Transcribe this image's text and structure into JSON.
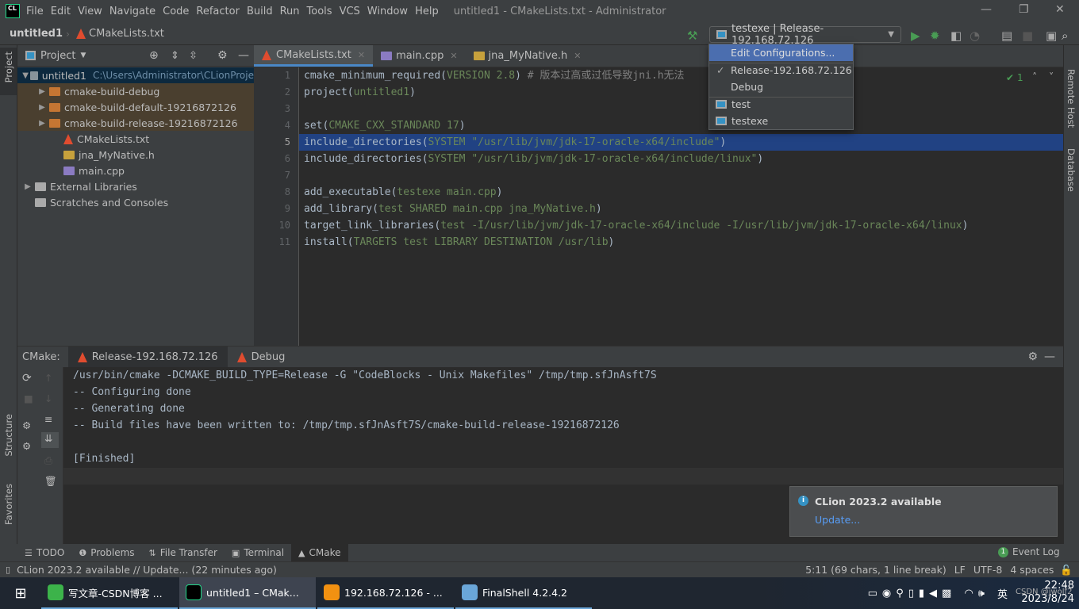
{
  "app": {
    "logo": "CL",
    "title": "untitled1 - CMakeLists.txt - Administrator"
  },
  "menu": [
    "File",
    "Edit",
    "View",
    "Navigate",
    "Code",
    "Refactor",
    "Build",
    "Run",
    "Tools",
    "VCS",
    "Window",
    "Help"
  ],
  "breadcrumb": {
    "project": "untitled1",
    "file": "CMakeLists.txt"
  },
  "run_config": {
    "selected": "testexe | Release-192.168.72.126"
  },
  "dropdown": {
    "edit": "Edit Configurations...",
    "profiles": [
      "Release-192.168.72.126",
      "Debug"
    ],
    "checked": "Release-192.168.72.126",
    "targets": [
      "test",
      "testexe"
    ]
  },
  "left_strip": {
    "project": "Project",
    "structure": "Structure",
    "favorites": "Favorites"
  },
  "right_strip": {
    "remote": "Remote Host",
    "database": "Database"
  },
  "project_panel": {
    "title": "Project",
    "tree": [
      {
        "label": "untitled1",
        "extra": "C:\\Users\\Administrator\\CLionProje",
        "type": "root"
      },
      {
        "label": "cmake-build-debug",
        "type": "folder"
      },
      {
        "label": "cmake-build-default-19216872126",
        "type": "folder"
      },
      {
        "label": "cmake-build-release-19216872126",
        "type": "folder"
      },
      {
        "label": "CMakeLists.txt",
        "type": "cmake"
      },
      {
        "label": "jna_MyNative.h",
        "type": "header"
      },
      {
        "label": "main.cpp",
        "type": "cpp"
      },
      {
        "label": "External Libraries",
        "type": "lib"
      },
      {
        "label": "Scratches and Consoles",
        "type": "scratch"
      }
    ]
  },
  "editor": {
    "tabs": [
      "CMakeLists.txt",
      "main.cpp",
      "jna_MyNative.h"
    ],
    "active_tab": "CMakeLists.txt",
    "inspection_count": "1",
    "current_line": 5,
    "lines": [
      [
        [
          "cmake_minimum_required(",
          ""
        ],
        [
          "VERSION 2.8",
          "g"
        ],
        [
          ") ",
          ""
        ],
        [
          "# 版本过高或过低导致jni.h无法",
          "c"
        ]
      ],
      [
        [
          "project(",
          ""
        ],
        [
          "untitled1",
          "g"
        ],
        [
          ")",
          ""
        ]
      ],
      [],
      [
        [
          "set(",
          ""
        ],
        [
          "CMAKE_CXX_STANDARD 17",
          "g"
        ],
        [
          ")",
          ""
        ]
      ],
      [
        [
          "include_directories(",
          ""
        ],
        [
          "SYSTEM \"/usr/lib/jvm/jdk-17-oracle-x64/include\"",
          "g"
        ],
        [
          ")",
          ""
        ]
      ],
      [
        [
          "include_directories(",
          ""
        ],
        [
          "SYSTEM \"/usr/lib/jvm/jdk-17-oracle-x64/include/linux\"",
          "g"
        ],
        [
          ")",
          ""
        ]
      ],
      [],
      [
        [
          "add_executable(",
          ""
        ],
        [
          "testexe main.cpp",
          "g"
        ],
        [
          ")",
          ""
        ]
      ],
      [
        [
          "add_library(",
          ""
        ],
        [
          "test SHARED main.cpp jna_MyNative.h",
          "g"
        ],
        [
          ")",
          ""
        ]
      ],
      [
        [
          "target_link_libraries(",
          ""
        ],
        [
          "test -I/usr/lib/jvm/jdk-17-oracle-x64/include -I/usr/lib/jvm/jdk-17-oracle-x64/linux",
          "g"
        ],
        [
          ")",
          ""
        ]
      ],
      [
        [
          "install(",
          ""
        ],
        [
          "TARGETS test LIBRARY DESTINATION /usr/lib",
          "g"
        ],
        [
          ")",
          ""
        ]
      ]
    ]
  },
  "cmake_panel": {
    "label": "CMake:",
    "tabs": [
      "Release-192.168.72.126",
      "Debug"
    ],
    "output": [
      "/usr/bin/cmake -DCMAKE_BUILD_TYPE=Release -G \"CodeBlocks - Unix Makefiles\" /tmp/tmp.sfJnAsft7S",
      "-- Configuring done",
      "-- Generating done",
      "-- Build files have been written to: /tmp/tmp.sfJnAsft7S/cmake-build-release-19216872126",
      "",
      "[Finished]"
    ]
  },
  "notification": {
    "title": "CLion 2023.2 available",
    "link": "Update..."
  },
  "tool_windows": [
    "TODO",
    "Problems",
    "File Transfer",
    "Terminal",
    "CMake"
  ],
  "active_tool": "CMake",
  "event_log": {
    "count": "1",
    "label": "Event Log"
  },
  "status": {
    "message": "CLion 2023.2 available // Update... (22 minutes ago)",
    "position": "5:11 (69 chars, 1 line break)",
    "line_sep": "LF",
    "encoding": "UTF-8",
    "indent": "4 spaces"
  },
  "taskbar": {
    "apps": [
      {
        "label": "写文章-CSDN博客 ...",
        "color": "#3cb34a"
      },
      {
        "label": "untitled1 – CMak...",
        "color": "#000000"
      },
      {
        "label": "192.168.72.126 - ...",
        "color": "#f29111"
      },
      {
        "label": "FinalShell 4.2.4.2",
        "color": "#6aa6d8"
      }
    ],
    "ime": "英",
    "time": "22:48",
    "date": "2023/8/24",
    "watermark": "CSDN @jwolf2"
  }
}
